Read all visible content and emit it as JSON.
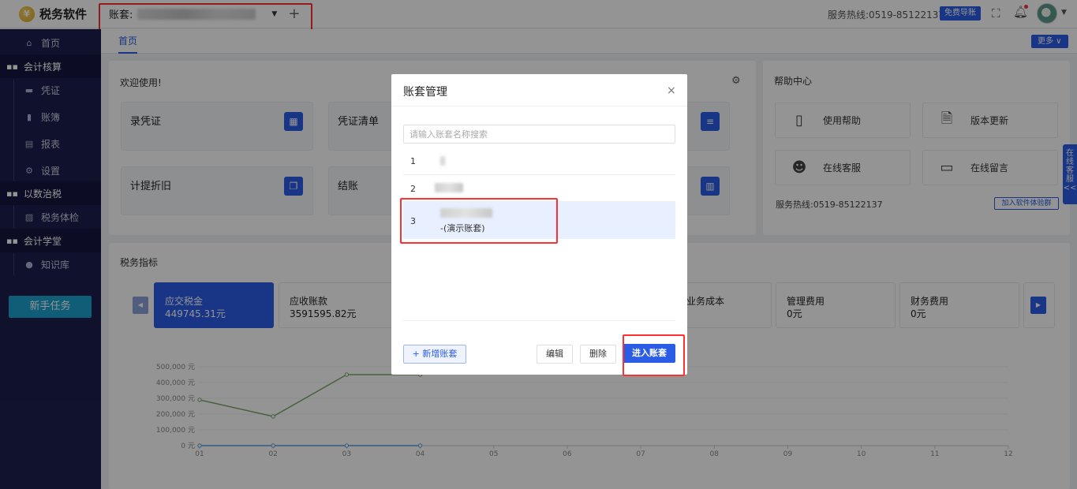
{
  "app": {
    "logo_text": "税务软件"
  },
  "topbar": {
    "ledger_label": "账套:",
    "hotline": "服务热线:0519-85122137",
    "free_guide": "免费导账"
  },
  "sidebar": {
    "items": [
      {
        "label": "首页",
        "icon": "home-icon"
      },
      {
        "label": "会计核算",
        "icon": "grid-icon",
        "group": true
      },
      {
        "label": "凭证",
        "icon": "voucher-icon"
      },
      {
        "label": "账簿",
        "icon": "book-icon"
      },
      {
        "label": "报表",
        "icon": "report-icon"
      },
      {
        "label": "设置",
        "icon": "gear-icon"
      },
      {
        "label": "以数治税",
        "icon": "grid-icon",
        "group": true
      },
      {
        "label": "税务体检",
        "icon": "chart-icon"
      },
      {
        "label": "会计学堂",
        "icon": "grid-icon",
        "group": true
      },
      {
        "label": "知识库",
        "icon": "location-icon"
      }
    ],
    "newbie_task": "新手任务"
  },
  "tabs": {
    "home": "首页",
    "more": "更多 ∨"
  },
  "welcome": {
    "title": "欢迎使用!",
    "cards": [
      "录凭证",
      "凭证清单",
      "计提折旧",
      "结账"
    ]
  },
  "help": {
    "title": "帮助中心",
    "items": [
      "使用帮助",
      "版本更新",
      "在线客服",
      "在线留言"
    ],
    "hotline": "服务热线:0519-85122137",
    "join_group": "加入软件体验群"
  },
  "tax_indicators": {
    "title": "税务指标",
    "kpis": [
      {
        "name": "应交税金",
        "value": "449745.31元"
      },
      {
        "name": "应收账款",
        "value": "3591595.82元"
      },
      {
        "name": "业务成本",
        "value": ""
      },
      {
        "name": "管理费用",
        "value": "0元"
      },
      {
        "name": "财务费用",
        "value": "0元"
      }
    ]
  },
  "side_tab": {
    "label": "在线客服<<"
  },
  "chart_data": {
    "type": "line",
    "x": [
      "01",
      "02",
      "03",
      "04",
      "05",
      "06",
      "07",
      "08",
      "09",
      "10",
      "11",
      "12"
    ],
    "y_ticks": [
      "0 元",
      "100,000 元",
      "200,000 元",
      "300,000 元",
      "400,000 元",
      "500,000 元"
    ],
    "ylim": [
      0,
      500000
    ],
    "series": [
      {
        "values": [
          290000,
          185000,
          450000,
          450000
        ],
        "color": "#7aa86a"
      },
      {
        "values": [
          0,
          0,
          0,
          0
        ],
        "color": "#5b9bd5"
      }
    ]
  },
  "modal": {
    "title": "账套管理",
    "close": "×",
    "search_placeholder": "请输入账套名称搜索",
    "rows": [
      {
        "index": "1",
        "sub": ""
      },
      {
        "index": "2",
        "sub": ""
      },
      {
        "index": "3",
        "sub": "-(演示账套)"
      }
    ],
    "buttons": {
      "add": "+ 新增账套",
      "edit": "编辑",
      "delete": "删除",
      "enter": "进入账套"
    }
  }
}
